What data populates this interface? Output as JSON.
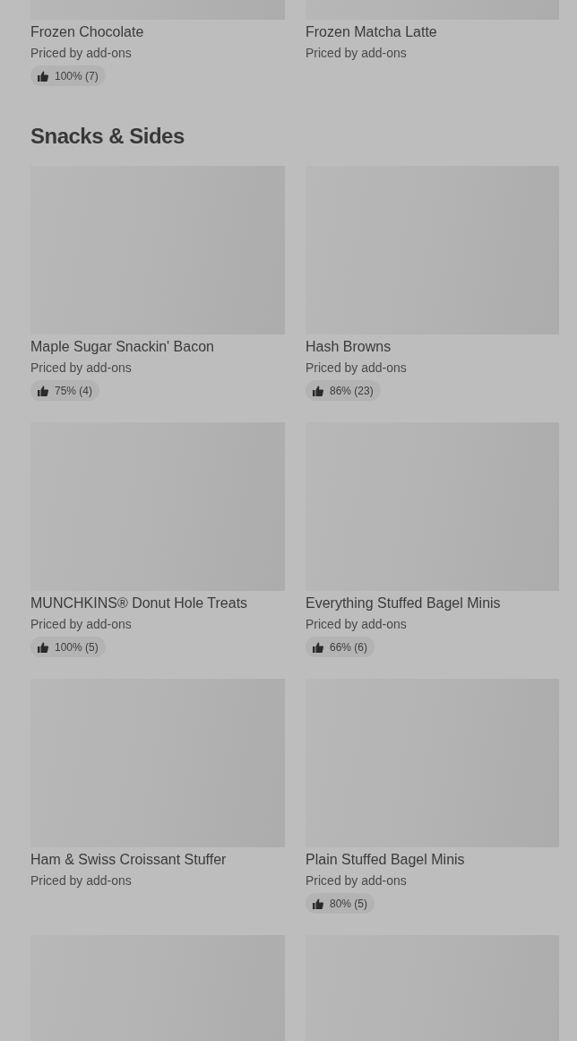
{
  "sections": [
    {
      "items": [
        {
          "kind": "item",
          "name": "Frozen Chocolate",
          "price": "Priced by add-ons",
          "rating": "100% (7)"
        },
        {
          "kind": "item",
          "name": "Frozen Matcha Latte",
          "price": "Priced by add-ons"
        }
      ]
    },
    {
      "title": "Snacks & Sides",
      "items": [
        {
          "kind": "item",
          "name": "Maple Sugar Snackin' Bacon",
          "price": "Priced by add-ons",
          "rating": "75% (4)"
        },
        {
          "kind": "item",
          "name": "Hash Browns",
          "price": "Priced by add-ons",
          "rating": "86% (23)"
        },
        {
          "kind": "item",
          "name": "MUNCHKINS® Donut Hole Treats",
          "price": "Priced by add-ons",
          "rating": "100% (5)"
        },
        {
          "kind": "item",
          "name": "Everything Stuffed Bagel Minis",
          "price": "Priced by add-ons",
          "rating": "66% (6)"
        },
        {
          "kind": "item",
          "name": "Ham & Swiss Croissant Stuffer",
          "price": "Priced by add-ons"
        },
        {
          "kind": "item",
          "name": "Plain Stuffed Bagel Minis",
          "price": "Priced by add-ons",
          "rating": "80% (5)"
        },
        {
          "kind": "image_only"
        },
        {
          "kind": "image_only"
        }
      ]
    }
  ]
}
